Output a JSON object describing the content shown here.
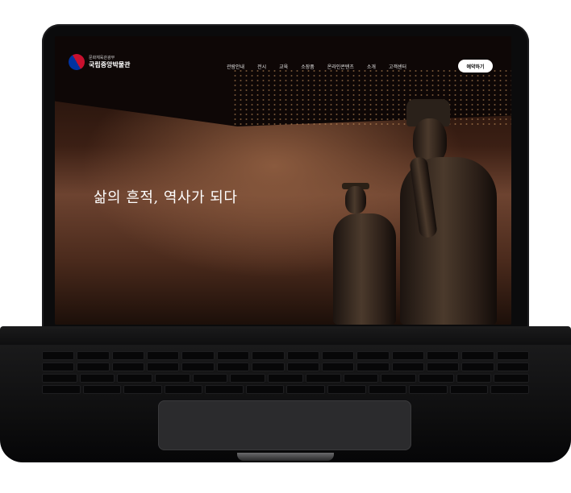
{
  "site": {
    "logo_sub": "문화체육관광부",
    "logo_main": "국립중앙박물관"
  },
  "nav": {
    "items": [
      "관람안내",
      "전시",
      "교육",
      "소장품",
      "온라인콘텐츠",
      "소개",
      "고객센터"
    ],
    "reserve_label": "예약하기"
  },
  "hero": {
    "headline": "삶의 흔적, 역사가 되다"
  },
  "colors": {
    "logo_red": "#c8102e",
    "logo_blue": "#0033a0",
    "hero_tone": "#6d4330"
  }
}
